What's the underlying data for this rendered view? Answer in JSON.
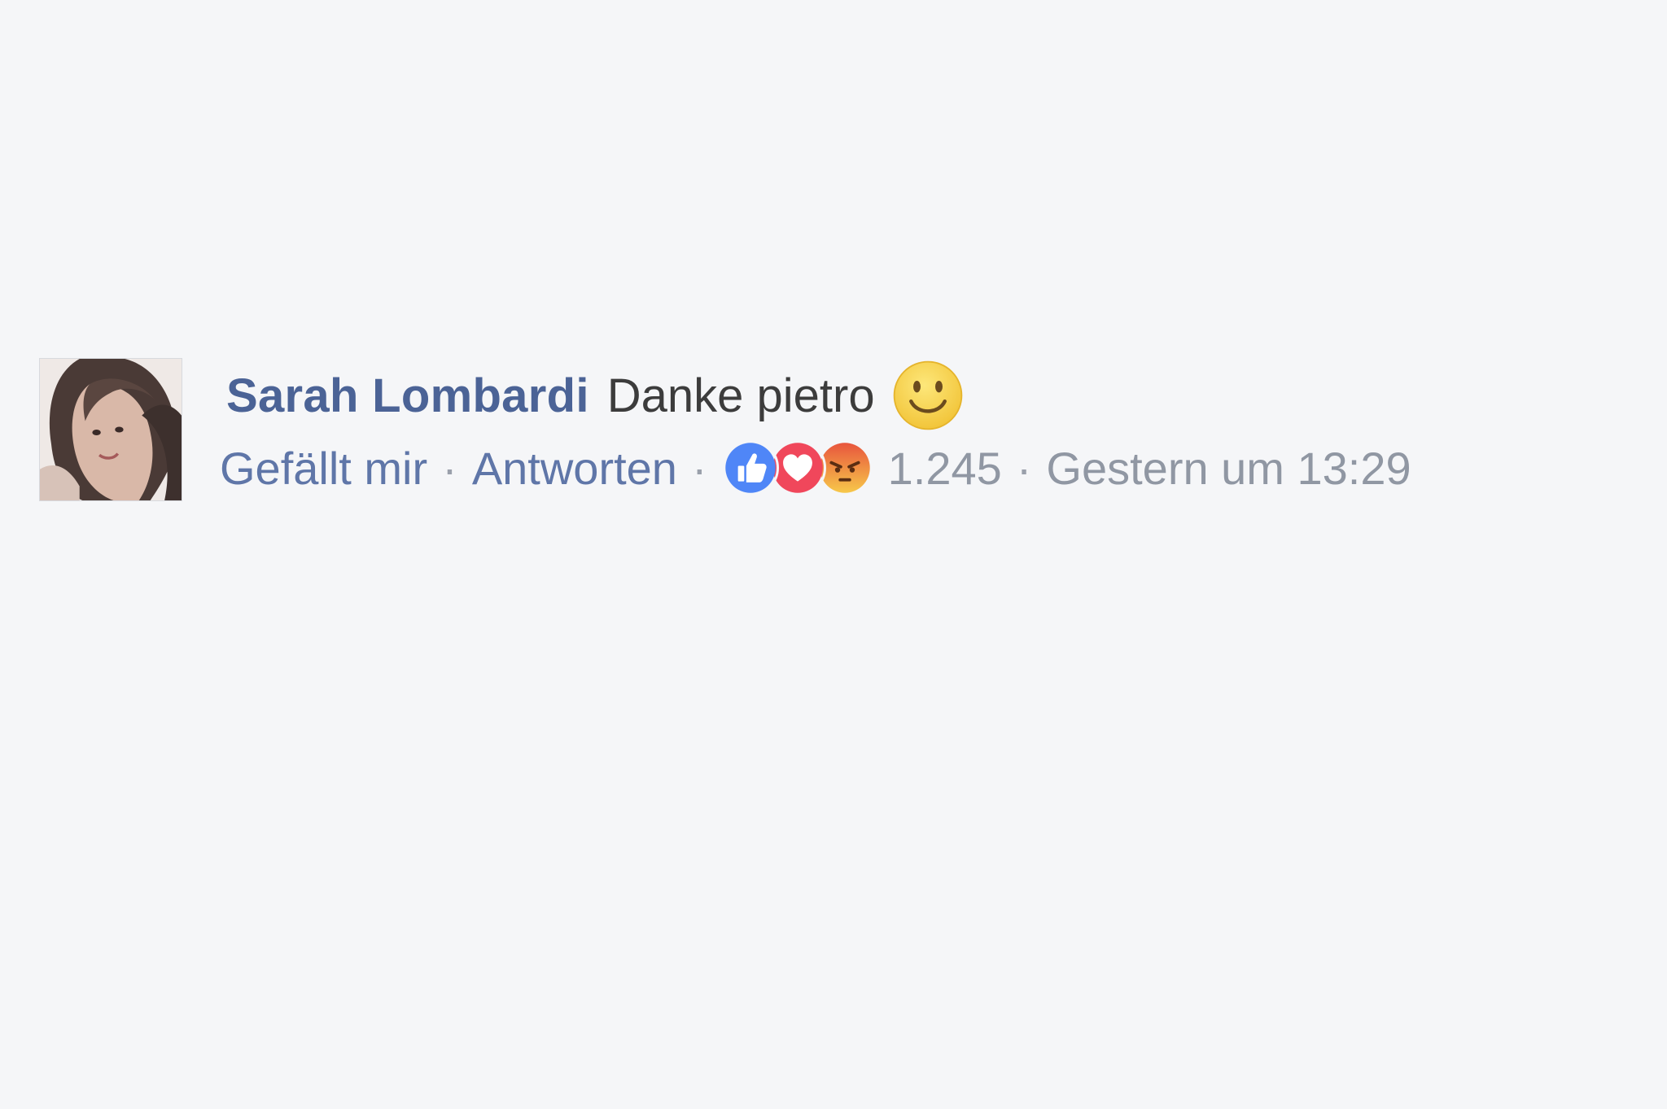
{
  "comment": {
    "author": "Sarah Lombardi",
    "text": "Danke pietro",
    "emoji": "smiley-emoji",
    "actions": {
      "like": "Gefällt mir",
      "reply": "Antworten"
    },
    "separator": "·",
    "reactions": {
      "icons": [
        "like-reaction-icon",
        "love-reaction-icon",
        "angry-reaction-icon"
      ],
      "count": "1.245"
    },
    "timestamp": "Gestern um 13:29"
  },
  "colors": {
    "background": "#f5f6f8",
    "author": "#4b6396",
    "action_link": "#5f76a8",
    "meta_text": "#9097a3",
    "like_blue": "#4f86f7",
    "love_red": "#f0475b",
    "emoji_yellow": "#f7cf3c"
  }
}
